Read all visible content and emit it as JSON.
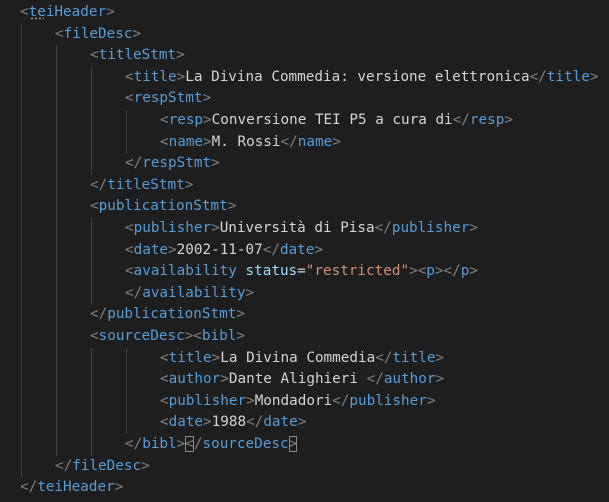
{
  "editor": {
    "lines": [
      {
        "indent": 0,
        "tokens": [
          [
            "p",
            "<"
          ],
          [
            "t",
            "teiHeader"
          ],
          [
            "p",
            ">"
          ]
        ]
      },
      {
        "indent": 1,
        "tokens": [
          [
            "p",
            "<"
          ],
          [
            "t",
            "fileDesc"
          ],
          [
            "p",
            ">"
          ]
        ]
      },
      {
        "indent": 2,
        "tokens": [
          [
            "p",
            "<"
          ],
          [
            "t",
            "titleStmt"
          ],
          [
            "p",
            ">"
          ]
        ]
      },
      {
        "indent": 3,
        "tokens": [
          [
            "p",
            "<"
          ],
          [
            "t",
            "title"
          ],
          [
            "p",
            ">"
          ],
          [
            "x",
            "La Divina Commedia: versione elettronica"
          ],
          [
            "p",
            "</"
          ],
          [
            "t",
            "title"
          ],
          [
            "p",
            ">"
          ]
        ]
      },
      {
        "indent": 3,
        "tokens": [
          [
            "p",
            "<"
          ],
          [
            "t",
            "respStmt"
          ],
          [
            "p",
            ">"
          ]
        ]
      },
      {
        "indent": 4,
        "tokens": [
          [
            "p",
            "<"
          ],
          [
            "t",
            "resp"
          ],
          [
            "p",
            ">"
          ],
          [
            "x",
            "Conversione TEI P5 a cura di"
          ],
          [
            "p",
            "</"
          ],
          [
            "t",
            "resp"
          ],
          [
            "p",
            ">"
          ]
        ]
      },
      {
        "indent": 4,
        "tokens": [
          [
            "p",
            "<"
          ],
          [
            "t",
            "name"
          ],
          [
            "p",
            ">"
          ],
          [
            "x",
            "M. Rossi"
          ],
          [
            "p",
            "</"
          ],
          [
            "t",
            "name"
          ],
          [
            "p",
            ">"
          ]
        ]
      },
      {
        "indent": 3,
        "tokens": [
          [
            "p",
            "</"
          ],
          [
            "t",
            "respStmt"
          ],
          [
            "p",
            ">"
          ]
        ]
      },
      {
        "indent": 2,
        "tokens": [
          [
            "p",
            "</"
          ],
          [
            "t",
            "titleStmt"
          ],
          [
            "p",
            ">"
          ]
        ]
      },
      {
        "indent": 2,
        "tokens": [
          [
            "p",
            "<"
          ],
          [
            "t",
            "publicationStmt"
          ],
          [
            "p",
            ">"
          ]
        ]
      },
      {
        "indent": 3,
        "tokens": [
          [
            "p",
            "<"
          ],
          [
            "t",
            "publisher"
          ],
          [
            "p",
            ">"
          ],
          [
            "x",
            "Università di Pisa"
          ],
          [
            "p",
            "</"
          ],
          [
            "t",
            "publisher"
          ],
          [
            "p",
            ">"
          ]
        ]
      },
      {
        "indent": 3,
        "tokens": [
          [
            "p",
            "<"
          ],
          [
            "t",
            "date"
          ],
          [
            "p",
            ">"
          ],
          [
            "x",
            "2002-11-07"
          ],
          [
            "p",
            "</"
          ],
          [
            "t",
            "date"
          ],
          [
            "p",
            ">"
          ]
        ]
      },
      {
        "indent": 3,
        "tokens": [
          [
            "p",
            "<"
          ],
          [
            "t",
            "availability"
          ],
          [
            "x",
            " "
          ],
          [
            "a",
            "status"
          ],
          [
            "eq",
            "="
          ],
          [
            "v",
            "\"restricted\""
          ],
          [
            "p",
            ">"
          ],
          [
            "p",
            "<"
          ],
          [
            "t",
            "p"
          ],
          [
            "p",
            "></"
          ],
          [
            "t",
            "p"
          ],
          [
            "p",
            ">"
          ]
        ]
      },
      {
        "indent": 3,
        "tokens": [
          [
            "p",
            "</"
          ],
          [
            "t",
            "availability"
          ],
          [
            "p",
            ">"
          ]
        ]
      },
      {
        "indent": 2,
        "tokens": [
          [
            "p",
            "</"
          ],
          [
            "t",
            "publicationStmt"
          ],
          [
            "p",
            ">"
          ]
        ]
      },
      {
        "indent": 2,
        "tokens": [
          [
            "p",
            "<"
          ],
          [
            "t",
            "sourceDesc"
          ],
          [
            "p",
            "><"
          ],
          [
            "t",
            "bibl"
          ],
          [
            "p",
            ">"
          ]
        ]
      },
      {
        "indent": 4,
        "tokens": [
          [
            "p",
            "<"
          ],
          [
            "t",
            "title"
          ],
          [
            "p",
            ">"
          ],
          [
            "x",
            "La Divina Commedia"
          ],
          [
            "p",
            "</"
          ],
          [
            "t",
            "title"
          ],
          [
            "p",
            ">"
          ]
        ]
      },
      {
        "indent": 4,
        "tokens": [
          [
            "p",
            "<"
          ],
          [
            "t",
            "author"
          ],
          [
            "p",
            ">"
          ],
          [
            "x",
            "Dante Alighieri "
          ],
          [
            "p",
            "</"
          ],
          [
            "t",
            "author"
          ],
          [
            "p",
            ">"
          ]
        ]
      },
      {
        "indent": 4,
        "tokens": [
          [
            "p",
            "<"
          ],
          [
            "t",
            "publisher"
          ],
          [
            "p",
            ">"
          ],
          [
            "x",
            "Mondadori"
          ],
          [
            "p",
            "</"
          ],
          [
            "t",
            "publisher"
          ],
          [
            "p",
            ">"
          ]
        ]
      },
      {
        "indent": 4,
        "tokens": [
          [
            "p",
            "<"
          ],
          [
            "t",
            "date"
          ],
          [
            "p",
            ">"
          ],
          [
            "x",
            "1988"
          ],
          [
            "p",
            "</"
          ],
          [
            "t",
            "date"
          ],
          [
            "p",
            ">"
          ]
        ]
      },
      {
        "indent": 3,
        "tokens": [
          [
            "p",
            "</"
          ],
          [
            "t",
            "bibl"
          ],
          [
            "p",
            ">"
          ],
          [
            "pm",
            "<"
          ],
          [
            "p",
            "/"
          ],
          [
            "t",
            "sourceDesc"
          ],
          [
            "pm",
            ">"
          ]
        ]
      },
      {
        "indent": 1,
        "tokens": [
          [
            "p",
            "</"
          ],
          [
            "t",
            "fileDesc"
          ],
          [
            "p",
            ">"
          ]
        ]
      },
      {
        "indent": 0,
        "tokens": [
          [
            "p",
            "</"
          ],
          [
            "t",
            "teiHeader"
          ],
          [
            "p",
            ">"
          ]
        ]
      }
    ]
  },
  "colors": {
    "background": "#1e1e1e",
    "punctuation": "#808080",
    "tag": "#569cd6",
    "attribute": "#9cdcfe",
    "attribute_value": "#ce9178",
    "text": "#d4d4d4",
    "indent_guide": "#404040"
  }
}
